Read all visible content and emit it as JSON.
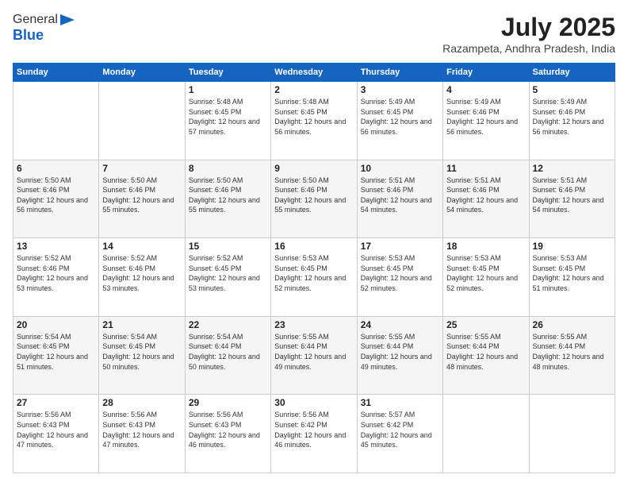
{
  "logo": {
    "general": "General",
    "blue": "Blue"
  },
  "title": {
    "month_year": "July 2025",
    "location": "Razampeta, Andhra Pradesh, India"
  },
  "days_of_week": [
    "Sunday",
    "Monday",
    "Tuesday",
    "Wednesday",
    "Thursday",
    "Friday",
    "Saturday"
  ],
  "weeks": [
    [
      {
        "day": "",
        "info": ""
      },
      {
        "day": "",
        "info": ""
      },
      {
        "day": "1",
        "info": "Sunrise: 5:48 AM\nSunset: 6:45 PM\nDaylight: 12 hours and 57 minutes."
      },
      {
        "day": "2",
        "info": "Sunrise: 5:48 AM\nSunset: 6:45 PM\nDaylight: 12 hours and 56 minutes."
      },
      {
        "day": "3",
        "info": "Sunrise: 5:49 AM\nSunset: 6:45 PM\nDaylight: 12 hours and 56 minutes."
      },
      {
        "day": "4",
        "info": "Sunrise: 5:49 AM\nSunset: 6:46 PM\nDaylight: 12 hours and 56 minutes."
      },
      {
        "day": "5",
        "info": "Sunrise: 5:49 AM\nSunset: 6:46 PM\nDaylight: 12 hours and 56 minutes."
      }
    ],
    [
      {
        "day": "6",
        "info": "Sunrise: 5:50 AM\nSunset: 6:46 PM\nDaylight: 12 hours and 56 minutes."
      },
      {
        "day": "7",
        "info": "Sunrise: 5:50 AM\nSunset: 6:46 PM\nDaylight: 12 hours and 55 minutes."
      },
      {
        "day": "8",
        "info": "Sunrise: 5:50 AM\nSunset: 6:46 PM\nDaylight: 12 hours and 55 minutes."
      },
      {
        "day": "9",
        "info": "Sunrise: 5:50 AM\nSunset: 6:46 PM\nDaylight: 12 hours and 55 minutes."
      },
      {
        "day": "10",
        "info": "Sunrise: 5:51 AM\nSunset: 6:46 PM\nDaylight: 12 hours and 54 minutes."
      },
      {
        "day": "11",
        "info": "Sunrise: 5:51 AM\nSunset: 6:46 PM\nDaylight: 12 hours and 54 minutes."
      },
      {
        "day": "12",
        "info": "Sunrise: 5:51 AM\nSunset: 6:46 PM\nDaylight: 12 hours and 54 minutes."
      }
    ],
    [
      {
        "day": "13",
        "info": "Sunrise: 5:52 AM\nSunset: 6:46 PM\nDaylight: 12 hours and 53 minutes."
      },
      {
        "day": "14",
        "info": "Sunrise: 5:52 AM\nSunset: 6:46 PM\nDaylight: 12 hours and 53 minutes."
      },
      {
        "day": "15",
        "info": "Sunrise: 5:52 AM\nSunset: 6:45 PM\nDaylight: 12 hours and 53 minutes."
      },
      {
        "day": "16",
        "info": "Sunrise: 5:53 AM\nSunset: 6:45 PM\nDaylight: 12 hours and 52 minutes."
      },
      {
        "day": "17",
        "info": "Sunrise: 5:53 AM\nSunset: 6:45 PM\nDaylight: 12 hours and 52 minutes."
      },
      {
        "day": "18",
        "info": "Sunrise: 5:53 AM\nSunset: 6:45 PM\nDaylight: 12 hours and 52 minutes."
      },
      {
        "day": "19",
        "info": "Sunrise: 5:53 AM\nSunset: 6:45 PM\nDaylight: 12 hours and 51 minutes."
      }
    ],
    [
      {
        "day": "20",
        "info": "Sunrise: 5:54 AM\nSunset: 6:45 PM\nDaylight: 12 hours and 51 minutes."
      },
      {
        "day": "21",
        "info": "Sunrise: 5:54 AM\nSunset: 6:45 PM\nDaylight: 12 hours and 50 minutes."
      },
      {
        "day": "22",
        "info": "Sunrise: 5:54 AM\nSunset: 6:44 PM\nDaylight: 12 hours and 50 minutes."
      },
      {
        "day": "23",
        "info": "Sunrise: 5:55 AM\nSunset: 6:44 PM\nDaylight: 12 hours and 49 minutes."
      },
      {
        "day": "24",
        "info": "Sunrise: 5:55 AM\nSunset: 6:44 PM\nDaylight: 12 hours and 49 minutes."
      },
      {
        "day": "25",
        "info": "Sunrise: 5:55 AM\nSunset: 6:44 PM\nDaylight: 12 hours and 48 minutes."
      },
      {
        "day": "26",
        "info": "Sunrise: 5:55 AM\nSunset: 6:44 PM\nDaylight: 12 hours and 48 minutes."
      }
    ],
    [
      {
        "day": "27",
        "info": "Sunrise: 5:56 AM\nSunset: 6:43 PM\nDaylight: 12 hours and 47 minutes."
      },
      {
        "day": "28",
        "info": "Sunrise: 5:56 AM\nSunset: 6:43 PM\nDaylight: 12 hours and 47 minutes."
      },
      {
        "day": "29",
        "info": "Sunrise: 5:56 AM\nSunset: 6:43 PM\nDaylight: 12 hours and 46 minutes."
      },
      {
        "day": "30",
        "info": "Sunrise: 5:56 AM\nSunset: 6:42 PM\nDaylight: 12 hours and 46 minutes."
      },
      {
        "day": "31",
        "info": "Sunrise: 5:57 AM\nSunset: 6:42 PM\nDaylight: 12 hours and 45 minutes."
      },
      {
        "day": "",
        "info": ""
      },
      {
        "day": "",
        "info": ""
      }
    ]
  ]
}
